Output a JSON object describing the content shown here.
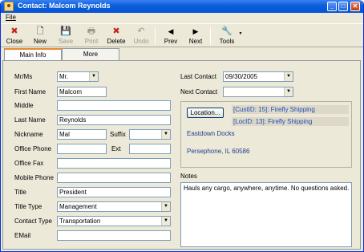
{
  "window": {
    "title": "Contact: Malcom Reynolds",
    "minimize": "_",
    "maximize": "□",
    "close": "✕"
  },
  "menu": {
    "file": "File"
  },
  "toolbar": {
    "close": {
      "label": "Close",
      "icon": "close-icon",
      "enabled": true,
      "glyph": "✖"
    },
    "new": {
      "label": "New",
      "icon": "new-document-icon",
      "enabled": true,
      "glyph": "🗋"
    },
    "save": {
      "label": "Save",
      "icon": "save-icon",
      "enabled": false,
      "glyph": "💾"
    },
    "print": {
      "label": "Print",
      "icon": "print-icon",
      "enabled": false,
      "glyph": "🖶"
    },
    "delete": {
      "label": "Delete",
      "icon": "delete-icon",
      "enabled": true,
      "glyph": "✖"
    },
    "undo": {
      "label": "Undo",
      "icon": "undo-icon",
      "enabled": false,
      "glyph": "↶"
    },
    "prev": {
      "label": "Prev",
      "icon": "arrow-left-icon",
      "enabled": true,
      "glyph": "◀"
    },
    "next": {
      "label": "Next",
      "icon": "arrow-right-icon",
      "enabled": true,
      "glyph": "▶"
    },
    "tools": {
      "label": "Tools",
      "icon": "tools-icon",
      "enabled": true,
      "glyph": "🔧",
      "arrow": "▼"
    }
  },
  "tabs": {
    "main_info": "Main Info",
    "more": "More"
  },
  "form": {
    "mr_ms": {
      "label": "Mr/Ms",
      "value": "Mr."
    },
    "first_name": {
      "label": "First Name",
      "value": "Malcom"
    },
    "middle": {
      "label": "Middle",
      "value": ""
    },
    "last_name": {
      "label": "Last Name",
      "value": "Reynolds"
    },
    "nickname": {
      "label": "Nickname",
      "value": "Mal"
    },
    "suffix": {
      "label": "Suffix",
      "value": ""
    },
    "office_phone": {
      "label": "Office Phone",
      "value": ""
    },
    "ext": {
      "label": "Ext",
      "value": ""
    },
    "office_fax": {
      "label": "Office Fax",
      "value": ""
    },
    "mobile_phone": {
      "label": "Mobile Phone",
      "value": ""
    },
    "title": {
      "label": "Title",
      "value": "President"
    },
    "title_type": {
      "label": "Title Type",
      "value": "Management"
    },
    "contact_type": {
      "label": "Contact Type",
      "value": "Transportation"
    },
    "email": {
      "label": "EMail",
      "value": ""
    },
    "last_contact": {
      "label": "Last Contact",
      "value": "09/30/2005"
    },
    "next_contact": {
      "label": "Next Contact",
      "value": ""
    }
  },
  "location": {
    "button": "Location...",
    "cust_id": "[CustID: 15]: Firefly Shipping",
    "loc_id": "[LocID: 13]: Firefly Shipping",
    "address_line1": "Eastdown Docks",
    "address_line2": "Persephone, IL  60586"
  },
  "notes": {
    "label": "Notes",
    "value": "Hauls any cargo, anywhere, anytime. No questions asked."
  },
  "dropdown_arrow": "▼"
}
